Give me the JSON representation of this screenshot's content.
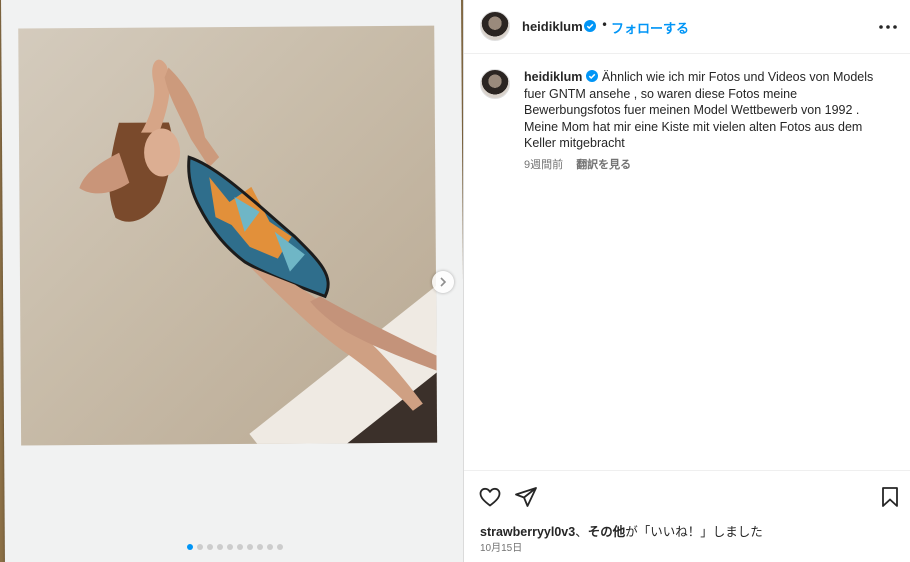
{
  "post": {
    "image_alt": "Polaroid photo",
    "carousel": {
      "slide_count": 10,
      "active_index": 0
    }
  },
  "header": {
    "username": "heidiklum",
    "separator": "•",
    "follow_label": "フォローする"
  },
  "caption": {
    "username": "heidiklum",
    "text": "Ähnlich wie ich mir Fotos und Videos von Models fuer GNTM ansehe , so waren diese Fotos meine Bewerbungsfotos fuer meinen Model Wettbewerb von 1992 . Meine Mom hat mir eine Kiste mit vielen alten Fotos aus dem Keller mitgebracht",
    "time_ago": "9週間前",
    "translate_label": "翻訳を見る"
  },
  "likes": {
    "first_user": "strawberryyl0v3",
    "joiner": "、",
    "others_label": "その他",
    "suffix": "が「いいね！」しました"
  },
  "date": "10月15日",
  "colors": {
    "accent": "#0095f6",
    "verified_badge": "#0095f6",
    "text": "#262626",
    "muted": "#737373",
    "background_wood": "#8c7046"
  },
  "icons": {
    "verified": "verified-badge-icon",
    "more": "more-horizontal-icon",
    "like": "heart-outline-icon",
    "share": "paper-plane-icon",
    "save": "bookmark-outline-icon",
    "next": "chevron-right-icon"
  }
}
